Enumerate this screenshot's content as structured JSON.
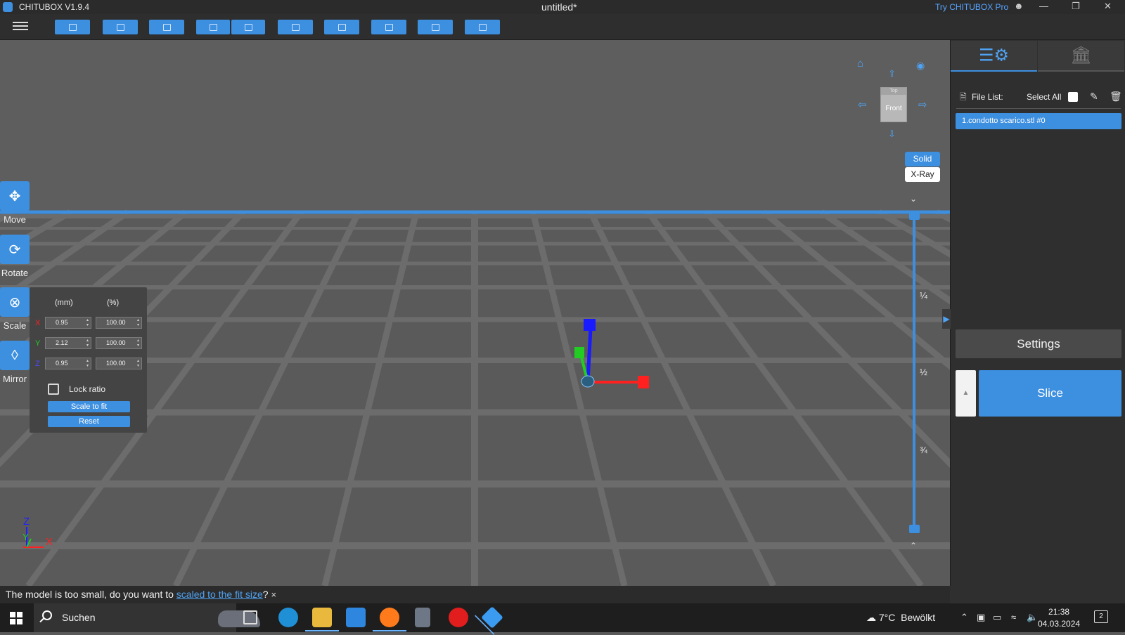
{
  "window": {
    "app_title": "CHITUBOX V1.9.4",
    "doc_title": "untitled*",
    "try_pro": "Try CHITUBOX Pro"
  },
  "toolbar": {
    "buttons": [
      "open-file-icon",
      "save-icon",
      "fit-icon",
      "undo-icon",
      "redo-icon",
      "repair-icon",
      "arrange-icon",
      "support-icon",
      "hollow-icon",
      "dig-hole-icon"
    ]
  },
  "tools": {
    "move": "Move",
    "rotate": "Rotate",
    "scale": "Scale",
    "mirror": "Mirror"
  },
  "scale_panel": {
    "col_mm": "(mm)",
    "col_pct": "(%)",
    "x_label": "X",
    "y_label": "Y",
    "z_label": "Z",
    "x_mm": "0.95",
    "x_pct": "100.00",
    "y_mm": "2.12",
    "y_pct": "100.00",
    "z_mm": "0.95",
    "z_pct": "100.00",
    "lock_ratio": "Lock ratio",
    "lock_ratio_checked": false,
    "scale_to_fit": "Scale to fit",
    "reset": "Reset"
  },
  "view": {
    "cube_top": "Top",
    "cube_front": "Front",
    "solid": "Solid",
    "xray": "X-Ray",
    "layer_fractions": [
      "¼",
      "½",
      "¾"
    ],
    "axis_labels": {
      "z": "Z",
      "y": "Y",
      "x": "X"
    }
  },
  "right_panel": {
    "file_list_label": "File List:",
    "select_all": "Select All",
    "files": [
      "1.condotto scarico.stl #0"
    ],
    "settings": "Settings",
    "slice": "Slice"
  },
  "notice": {
    "before": "The model is too small, do you want to ",
    "link": "scaled to the fit size",
    "after": "?",
    "close": "×"
  },
  "taskbar": {
    "search": "Suchen",
    "temperature": "7°C",
    "weather": "Bewölkt",
    "time": "21:38",
    "date": "04.03.2024",
    "notif_count": "2"
  },
  "colors": {
    "accent": "#3d8fe0",
    "axis_x": "#ff2020",
    "axis_y": "#22cc22",
    "axis_z": "#1a1aff"
  }
}
